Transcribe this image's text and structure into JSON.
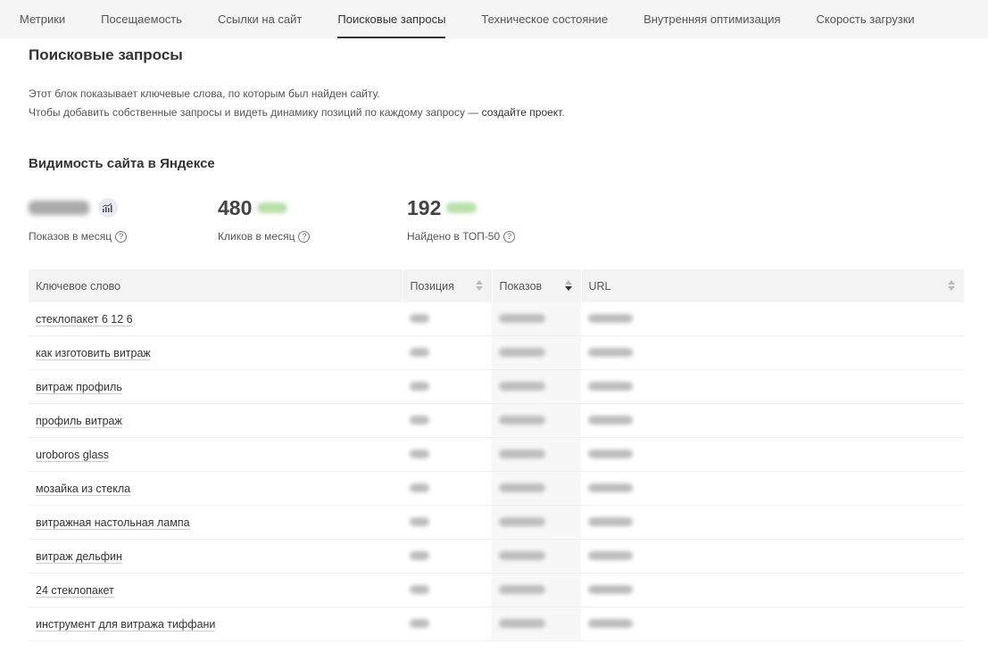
{
  "tabs": [
    {
      "label": "Метрики"
    },
    {
      "label": "Посещаемость"
    },
    {
      "label": "Ссылки на сайт"
    },
    {
      "label": "Поисковые запросы",
      "active": true
    },
    {
      "label": "Техническое состояние"
    },
    {
      "label": "Внутренняя оптимизация"
    },
    {
      "label": "Скорость загрузки"
    }
  ],
  "page": {
    "title": "Поисковые запросы",
    "desc_line1": "Этот блок показывает ключевые слова, по которым был найден сайту.",
    "desc_line2_prefix": "Чтобы добавить собственные запросы и видеть динамику позиций по каждому запросу — ",
    "desc_link": "создайте проект",
    "desc_line2_suffix": "."
  },
  "visibility": {
    "title": "Видимость сайта в Яндексе",
    "stats": [
      {
        "value": "",
        "label": "Показов в месяц",
        "icon": "chart-icon"
      },
      {
        "value": "480",
        "label": "Кликов в месяц"
      },
      {
        "value": "192",
        "label": "Найдено в ТОП-50"
      }
    ],
    "help_glyph": "?"
  },
  "table": {
    "headers": {
      "keyword": "Ключевое слово",
      "position": "Позиция",
      "shows": "Показов",
      "url": "URL"
    },
    "rows": [
      {
        "keyword": "стеклопакет 6 12 6"
      },
      {
        "keyword": "как изготовить витраж"
      },
      {
        "keyword": "витраж профиль"
      },
      {
        "keyword": "профиль витраж"
      },
      {
        "keyword": "uroboros glass"
      },
      {
        "keyword": "мозайка из стекла"
      },
      {
        "keyword": "витражная настольная лампа"
      },
      {
        "keyword": "витраж дельфин"
      },
      {
        "keyword": "24 стеклопакет"
      },
      {
        "keyword": "инструмент для витража тиффани"
      }
    ]
  },
  "colors": {
    "tab_bar": "#f5f5f5",
    "active_underline": "#333333",
    "delta_green": "#b8e0a8"
  }
}
